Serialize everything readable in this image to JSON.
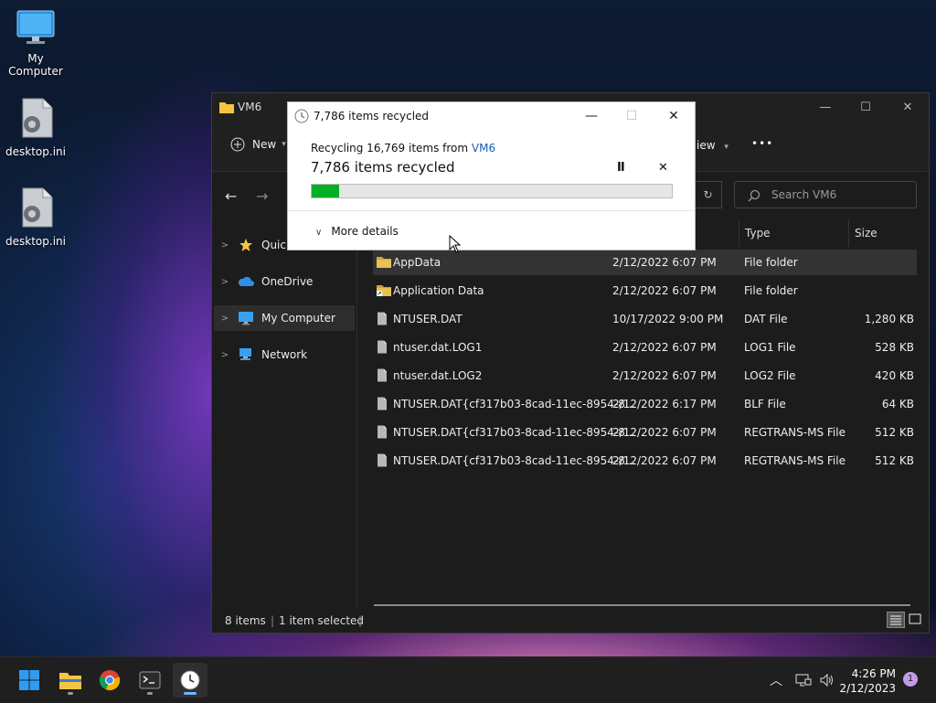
{
  "desktop": {
    "icons": [
      {
        "label": "My Computer"
      },
      {
        "label": "desktop.ini"
      },
      {
        "label": "desktop.ini"
      }
    ]
  },
  "explorer": {
    "title": "VM6",
    "toolbar": {
      "new_label": "New",
      "view_label": "iew",
      "more_label": "•••"
    },
    "search_placeholder": "Search VM6",
    "nav": [
      {
        "label": "Quick",
        "icon": "star-icon"
      },
      {
        "label": "OneDrive",
        "icon": "cloud-icon"
      },
      {
        "label": "My Computer",
        "icon": "monitor-icon"
      },
      {
        "label": "Network",
        "icon": "network-icon"
      }
    ],
    "columns": {
      "type": "Type",
      "size": "Size"
    },
    "files": [
      {
        "name": "AppData",
        "date": "2/12/2022 6:07 PM",
        "type": "File folder",
        "size": ""
      },
      {
        "name": "Application Data",
        "date": "2/12/2022 6:07 PM",
        "type": "File folder",
        "size": ""
      },
      {
        "name": "NTUSER.DAT",
        "date": "10/17/2022 9:00 PM",
        "type": "DAT File",
        "size": "1,280 KB"
      },
      {
        "name": "ntuser.dat.LOG1",
        "date": "2/12/2022 6:07 PM",
        "type": "LOG1 File",
        "size": "528 KB"
      },
      {
        "name": "ntuser.dat.LOG2",
        "date": "2/12/2022 6:07 PM",
        "type": "LOG2 File",
        "size": "420 KB"
      },
      {
        "name": "NTUSER.DAT{cf317b03-8cad-11ec-8954-8...",
        "date": "2/12/2022 6:17 PM",
        "type": "BLF File",
        "size": "64 KB"
      },
      {
        "name": "NTUSER.DAT{cf317b03-8cad-11ec-8954-8...",
        "date": "2/12/2022 6:07 PM",
        "type": "REGTRANS-MS File",
        "size": "512 KB"
      },
      {
        "name": "NTUSER.DAT{cf317b03-8cad-11ec-8954-8...",
        "date": "2/12/2022 6:07 PM",
        "type": "REGTRANS-MS File",
        "size": "512 KB"
      }
    ],
    "status": {
      "items": "8 items",
      "selected": "1 item selected"
    }
  },
  "dialog": {
    "title": "7,786 items recycled",
    "line1_prefix": "Recycling 16,769 items from ",
    "line1_link": "VM6",
    "headline": "7,786 items recycled",
    "progress_percent": 7.5,
    "pause_label": "II",
    "cancel_label": "✕",
    "more_details": "More details"
  },
  "taskbar": {
    "time": "4:26 PM",
    "date": "2/12/2023",
    "notifications": "1"
  },
  "colors": {
    "progress": "#06b025",
    "link": "#1a5fb4",
    "accent": "#6cb8ff"
  }
}
